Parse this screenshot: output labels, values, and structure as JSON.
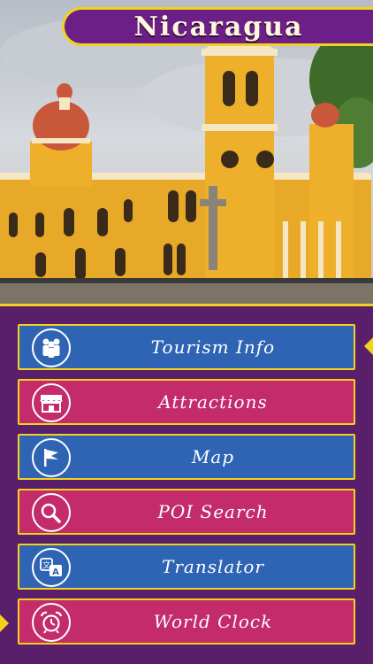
{
  "app": {
    "title": "Nicaragua"
  },
  "colors": {
    "panel_bg": "#5a1f6b",
    "banner_bg": "#6c1f86",
    "gold": "#f2d21c",
    "blue_button": "#2f64b5",
    "pink_button": "#c32b6a"
  },
  "menu": {
    "items": [
      {
        "label": "Tourism Info",
        "icon": "people-icon"
      },
      {
        "label": "Attractions",
        "icon": "storefront-icon"
      },
      {
        "label": "Map",
        "icon": "flag-icon"
      },
      {
        "label": "POI Search",
        "icon": "magnifier-icon"
      },
      {
        "label": "Translator",
        "icon": "translate-icon"
      },
      {
        "label": "World Clock",
        "icon": "alarm-clock-icon"
      }
    ]
  }
}
